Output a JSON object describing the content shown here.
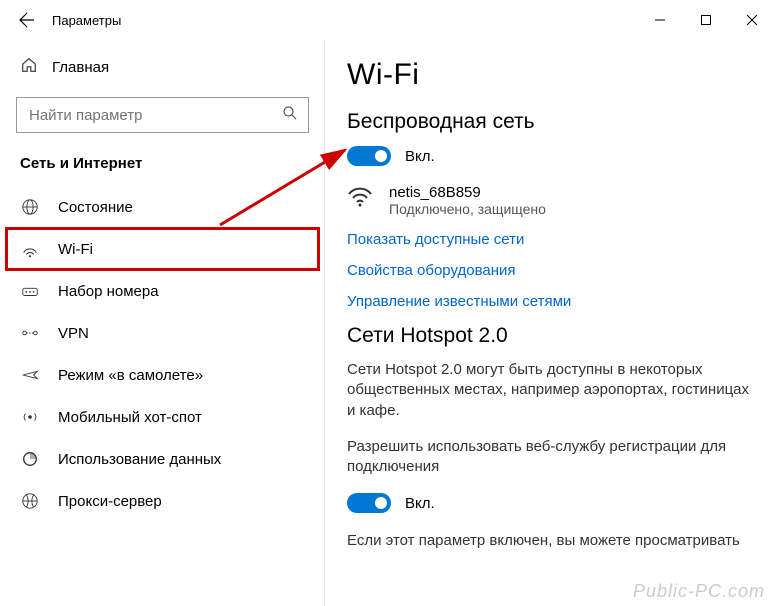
{
  "titlebar": {
    "title": "Параметры"
  },
  "sidebar": {
    "home": "Главная",
    "search_placeholder": "Найти параметр",
    "section": "Сеть и Интернет",
    "items": [
      {
        "label": "Состояние"
      },
      {
        "label": "Wi-Fi"
      },
      {
        "label": "Набор номера"
      },
      {
        "label": "VPN"
      },
      {
        "label": "Режим «в самолете»"
      },
      {
        "label": "Мобильный хот-спот"
      },
      {
        "label": "Использование данных"
      },
      {
        "label": "Прокси-сервер"
      }
    ]
  },
  "content": {
    "page_title": "Wi-Fi",
    "wireless_header": "Беспроводная сеть",
    "toggle1_label": "Вкл.",
    "network_name": "netis_68B859",
    "network_status": "Подключено, защищено",
    "link_show": "Показать доступные сети",
    "link_hw": "Свойства оборудования",
    "link_known": "Управление известными сетями",
    "hotspot_header": "Сети Hotspot 2.0",
    "hotspot_text": "Сети Hotspot 2.0 могут быть доступны в некоторых общественных местах, например аэропортах, гостиницах и кафе.",
    "hotspot_permission": "Разрешить использовать веб-службу регистрации для подключения",
    "toggle2_label": "Вкл.",
    "final_text": "Если этот параметр включен, вы можете просматривать"
  },
  "watermark": "Public-PC.com"
}
